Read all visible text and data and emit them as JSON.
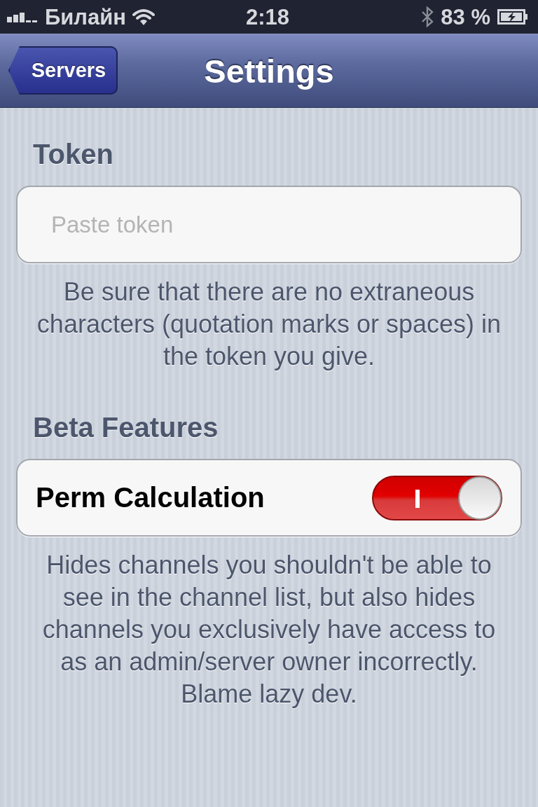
{
  "status_bar": {
    "carrier": "Билайн",
    "time": "2:18",
    "battery": "83 %"
  },
  "nav_bar": {
    "back_button": "Servers",
    "title": "Settings"
  },
  "sections": [
    {
      "kind": "field",
      "header": "Token",
      "field": {
        "placeholder": "Paste token"
      },
      "footer": "Be sure that there are no extraneous characters (quotation marks or spaces) in the token you give."
    },
    {
      "kind": "switch",
      "header": "Beta Features",
      "row": {
        "label": "Perm Calculation",
        "on": true
      },
      "footer": "Hides channels you shouldn't be able to see in the channel list, but also hides channels you exclusively have access to as an admin/server owner incorrectly. Blame lazy dev."
    }
  ]
}
